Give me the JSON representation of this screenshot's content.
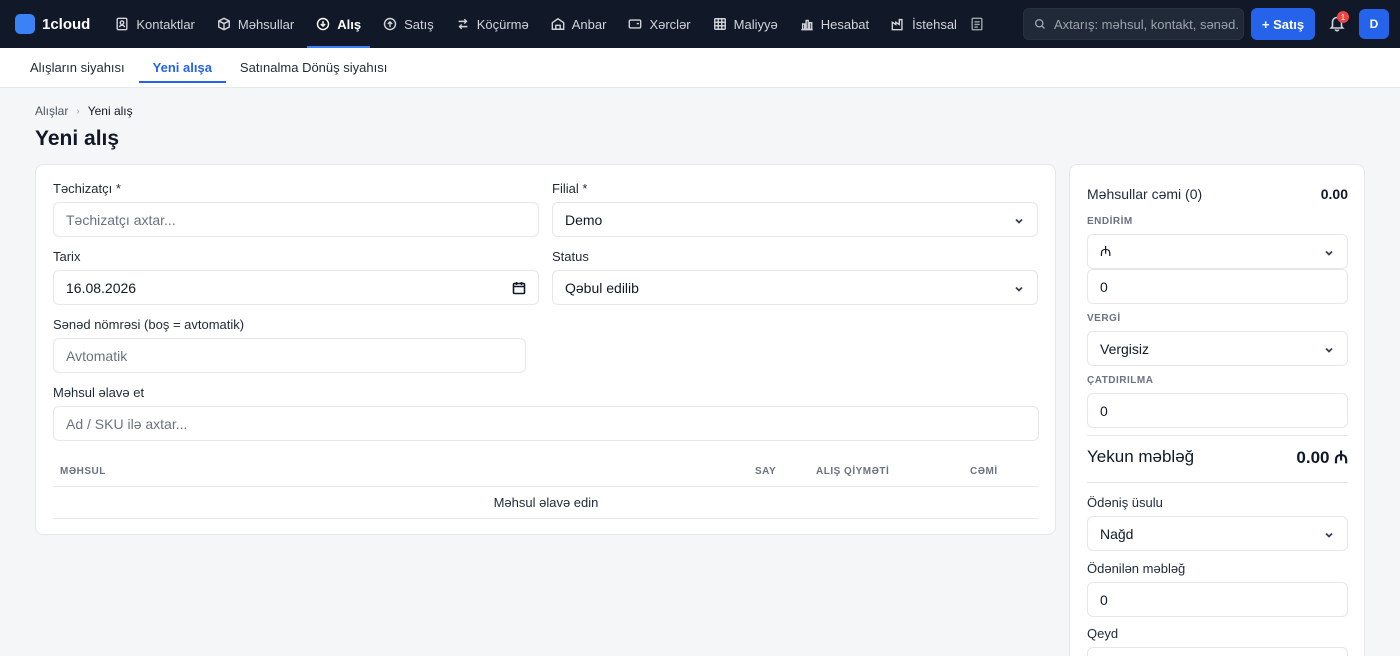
{
  "brand": {
    "name": "1cloud"
  },
  "nav": [
    {
      "label": "Kontaktlar",
      "icon": "contacts-icon",
      "active": false
    },
    {
      "label": "Məhsullar",
      "icon": "box-icon",
      "active": false
    },
    {
      "label": "Alış",
      "icon": "download-circle-icon",
      "active": true
    },
    {
      "label": "Satış",
      "icon": "upload-circle-icon",
      "active": false
    },
    {
      "label": "Köçürmə",
      "icon": "transfer-icon",
      "active": false
    },
    {
      "label": "Anbar",
      "icon": "warehouse-icon",
      "active": false
    },
    {
      "label": "Xərclər",
      "icon": "wallet-icon",
      "active": false
    },
    {
      "label": "Maliyyə",
      "icon": "grid-icon",
      "active": false
    },
    {
      "label": "Hesabat",
      "icon": "bar-chart-icon",
      "active": false
    },
    {
      "label": "İstehsal",
      "icon": "factory-icon",
      "active": false
    }
  ],
  "search": {
    "placeholder": "Axtarış: məhsul, kontakt, sənəd..."
  },
  "header": {
    "new_sale_label": "+ Satış",
    "notification_count": "1",
    "avatar_initial": "D"
  },
  "subtabs": [
    {
      "label": "Alışların siyahısı",
      "active": false
    },
    {
      "label": "Yeni alışa",
      "active": true
    },
    {
      "label": "Satınalma Dönüş siyahısı",
      "active": false
    }
  ],
  "breadcrumb": {
    "parent": "Alışlar",
    "current": "Yeni alış"
  },
  "page": {
    "title": "Yeni alış"
  },
  "form": {
    "supplier_label": "Təchizatçı *",
    "supplier_placeholder": "Təchizatçı axtar...",
    "branch_label": "Filial *",
    "branch_value": "Demo",
    "date_label": "Tarix",
    "date_value": "16.08.2026",
    "status_label": "Status",
    "status_value": "Qəbul edilib",
    "doc_number_label": "Sənəd nömrəsi (boş = avtomatik)",
    "doc_number_placeholder": "Avtomatik",
    "add_product_label": "Məhsul əlavə et",
    "add_product_placeholder": "Ad / SKU ilə axtar..."
  },
  "table": {
    "columns": [
      "MƏHSUL",
      "SAY",
      "ALIŞ QİYMƏTİ",
      "CƏMİ"
    ],
    "empty_text": "Məhsul əlavə edin"
  },
  "summary": {
    "products_total_label": "Məhsullar cəmi (0)",
    "products_total_value": "0.00",
    "discount_label": "ENDİRİM",
    "discount_type": "₼",
    "discount_value": "0",
    "tax_label": "VERGİ",
    "tax_value": "Vergisiz",
    "delivery_label": "ÇATDIRILMA",
    "delivery_value": "0",
    "final_label": "Yekun məbləğ",
    "final_value": "0.00 ₼",
    "payment_method_label": "Ödəniş üsulu",
    "payment_method_value": "Nağd",
    "paid_amount_label": "Ödənilən məbləğ",
    "paid_amount_value": "0",
    "note_label": "Qeyd"
  }
}
